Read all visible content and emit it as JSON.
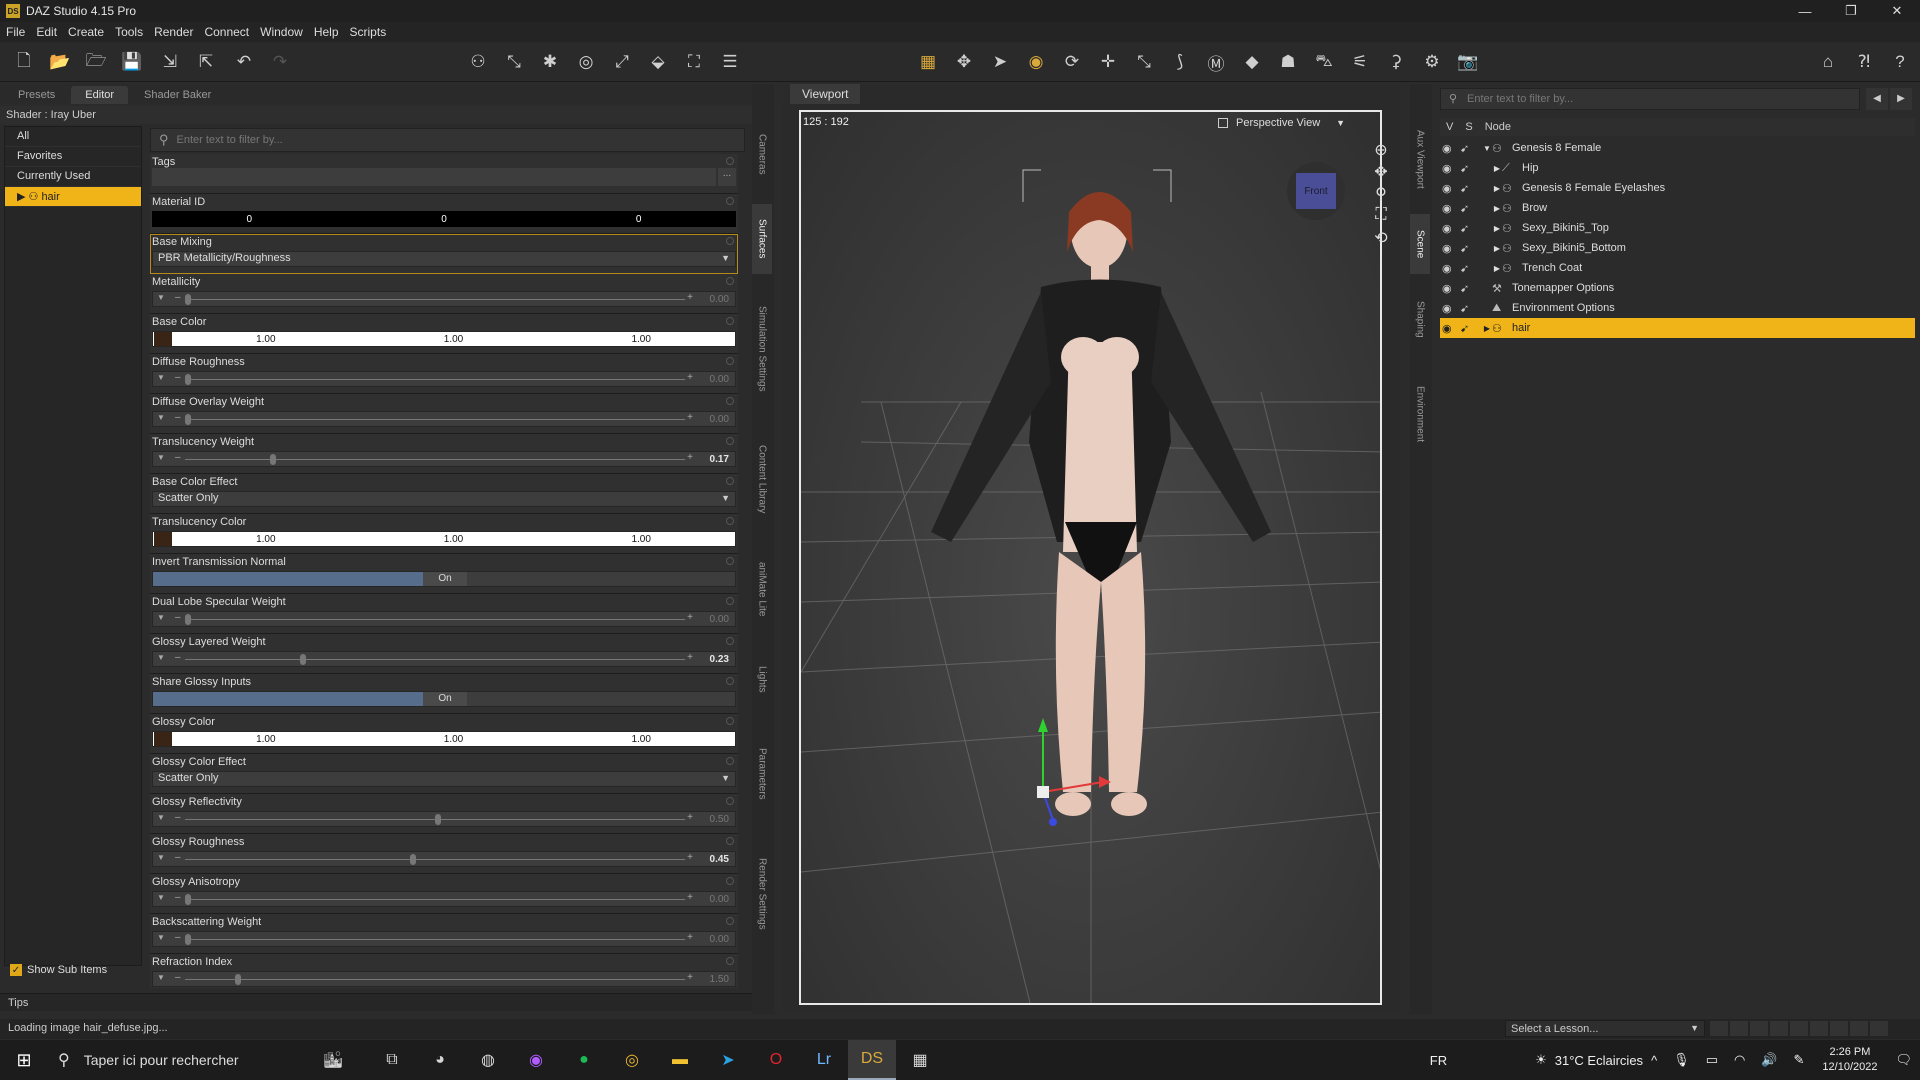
{
  "window": {
    "title": "DAZ Studio 4.15 Pro",
    "logo": "DS",
    "controls": [
      "—",
      "❐",
      "✕"
    ]
  },
  "menu": [
    "File",
    "Edit",
    "Create",
    "Tools",
    "Render",
    "Connect",
    "Window",
    "Help",
    "Scripts"
  ],
  "left_panel": {
    "tabs": [
      "Presets",
      "Editor",
      "Shader Baker"
    ],
    "shader": "Shader : Iray Uber",
    "categories": [
      "All",
      "Favorites",
      "Currently Used",
      "hair"
    ],
    "filter_placeholder": "Enter text to filter by...",
    "show_sub_items": "Show Sub Items",
    "tips": "Tips",
    "properties": [
      {
        "label": "Tags",
        "type": "tags",
        "btn": "..."
      },
      {
        "label": "Material ID",
        "type": "triple",
        "values": [
          "0",
          "0",
          "0"
        ]
      },
      {
        "label": "Base Mixing",
        "type": "select",
        "value": "PBR Metallicity/Roughness",
        "highlight": true
      },
      {
        "label": "Metallicity",
        "type": "slider",
        "value": "0.00",
        "pos": 0.0
      },
      {
        "label": "Base Color",
        "type": "color",
        "values": [
          "1.00",
          "1.00",
          "1.00"
        ]
      },
      {
        "label": "Diffuse Roughness",
        "type": "slider",
        "value": "0.00",
        "pos": 0.0
      },
      {
        "label": "Diffuse Overlay Weight",
        "type": "slider",
        "value": "0.00",
        "pos": 0.0
      },
      {
        "label": "Translucency Weight",
        "type": "slider",
        "value": "0.17",
        "pos": 0.17,
        "bold": true
      },
      {
        "label": "Base Color Effect",
        "type": "select",
        "value": "Scatter Only"
      },
      {
        "label": "Translucency Color",
        "type": "color",
        "values": [
          "1.00",
          "1.00",
          "1.00"
        ]
      },
      {
        "label": "Invert Transmission Normal",
        "type": "toggle",
        "value": "On"
      },
      {
        "label": "Dual Lobe Specular Weight",
        "type": "slider",
        "value": "0.00",
        "pos": 0.0
      },
      {
        "label": "Glossy Layered Weight",
        "type": "slider",
        "value": "0.23",
        "pos": 0.23,
        "bold": true
      },
      {
        "label": "Share Glossy Inputs",
        "type": "toggle",
        "value": "On"
      },
      {
        "label": "Glossy Color",
        "type": "color",
        "values": [
          "1.00",
          "1.00",
          "1.00"
        ]
      },
      {
        "label": "Glossy Color Effect",
        "type": "select",
        "value": "Scatter Only"
      },
      {
        "label": "Glossy Reflectivity",
        "type": "slider",
        "value": "0.50",
        "pos": 0.5
      },
      {
        "label": "Glossy Roughness",
        "type": "slider",
        "value": "0.45",
        "pos": 0.45,
        "bold": true
      },
      {
        "label": "Glossy Anisotropy",
        "type": "slider",
        "value": "0.00",
        "pos": 0.0
      },
      {
        "label": "Backscattering Weight",
        "type": "slider",
        "value": "0.00",
        "pos": 0.0
      },
      {
        "label": "Refraction Index",
        "type": "slider",
        "value": "1.50",
        "pos": 0.1
      }
    ]
  },
  "side_tabs_left": [
    "Cameras",
    "Surfaces",
    "Simulation Settings",
    "Content Library",
    "aniMate Lite",
    "Lights",
    "Parameters",
    "Render Settings"
  ],
  "side_tabs_right": [
    "Aux Viewport",
    "Scene",
    "Shaping",
    "Environment"
  ],
  "viewport": {
    "tab": "Viewport",
    "coords": "125 : 192",
    "view": "Perspective View",
    "cube_face": "Front"
  },
  "scene": {
    "filter_placeholder": "Enter text to filter by...",
    "headers": [
      "V",
      "S",
      "Node"
    ],
    "nodes": [
      {
        "name": "Genesis 8 Female",
        "indent": 0,
        "tri": "▼",
        "icon": "figure-icon"
      },
      {
        "name": "Hip",
        "indent": 1,
        "tri": "▶",
        "icon": "bone-icon"
      },
      {
        "name": "Genesis 8 Female Eyelashes",
        "indent": 1,
        "tri": "▶",
        "icon": "figure-icon"
      },
      {
        "name": "Brow",
        "indent": 1,
        "tri": "▶",
        "icon": "figure-icon"
      },
      {
        "name": "Sexy_Bikini5_Top",
        "indent": 1,
        "tri": "▶",
        "icon": "figure-icon"
      },
      {
        "name": "Sexy_Bikini5_Bottom",
        "indent": 1,
        "tri": "▶",
        "icon": "figure-icon"
      },
      {
        "name": "Trench Coat",
        "indent": 1,
        "tri": "▶",
        "icon": "figure-icon"
      },
      {
        "name": "Tonemapper Options",
        "indent": 0,
        "tri": "",
        "icon": "tonemapper-icon"
      },
      {
        "name": "Environment Options",
        "indent": 0,
        "tri": "",
        "icon": "environment-icon"
      },
      {
        "name": "hair",
        "indent": 0,
        "tri": "▶",
        "icon": "figure-icon",
        "selected": true
      }
    ]
  },
  "status": {
    "text": "Loading image hair_defuse.jpg...",
    "lesson": "Select a Lesson..."
  },
  "taskbar": {
    "search": "Taper ici pour rechercher",
    "lang": "FR",
    "weather": "31°C  Eclaircies",
    "time": "2:26 PM",
    "date": "12/10/2022"
  }
}
